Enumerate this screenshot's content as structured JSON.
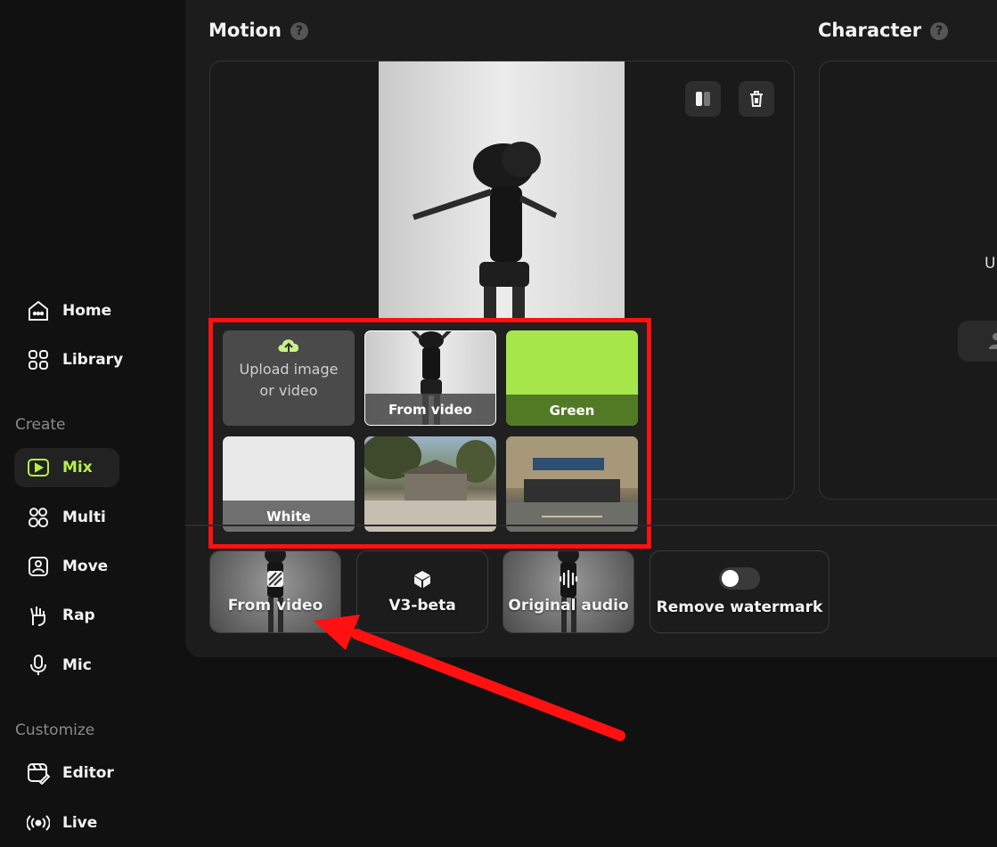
{
  "sidebar": {
    "items": [
      {
        "label": "Home",
        "icon": "home-icon"
      },
      {
        "label": "Library",
        "icon": "library-icon"
      }
    ],
    "create_label": "Create",
    "create_items": [
      {
        "label": "Mix",
        "icon": "mix-icon",
        "active": true
      },
      {
        "label": "Multi",
        "icon": "multi-icon"
      },
      {
        "label": "Move",
        "icon": "move-icon"
      },
      {
        "label": "Rap",
        "icon": "rap-icon"
      },
      {
        "label": "Mic",
        "icon": "mic-icon"
      }
    ],
    "customize_label": "Customize",
    "customize_items": [
      {
        "label": "Editor",
        "icon": "editor-icon"
      },
      {
        "label": "Live",
        "icon": "live-icon"
      }
    ]
  },
  "motion": {
    "title": "Motion",
    "help": "?"
  },
  "character": {
    "title": "Character",
    "help": "?",
    "upload_partial": "U"
  },
  "background_picker": {
    "upload_label": "Upload image or video",
    "tiles": [
      {
        "label": "From video",
        "selected": true
      },
      {
        "label": "Green",
        "color": "#a6e64a"
      },
      {
        "label": "White",
        "color": "#e8e8e8"
      },
      {
        "label": ""
      },
      {
        "label": ""
      }
    ],
    "highlight_color": "#ff1111"
  },
  "options": {
    "background_label": "From video",
    "model_label": "V3-beta",
    "audio_label": "Original audio",
    "watermark_label": "Remove watermark",
    "watermark_on": false
  },
  "colors": {
    "accent": "#b7f04a",
    "annotation": "#ff1111"
  }
}
